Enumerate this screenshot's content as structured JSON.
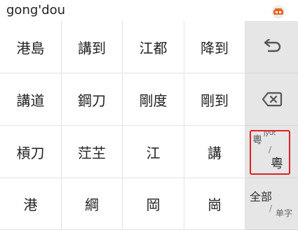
{
  "composition": {
    "text": "gong'dou"
  },
  "app": {
    "logo_icon": "ime-app-logo-icon"
  },
  "candidates": [
    [
      "港島",
      "講到",
      "江都",
      "降到"
    ],
    [
      "講道",
      "鋼刀",
      "剛度",
      "剛到"
    ],
    [
      "槓刀",
      "茳芏",
      "江",
      "講"
    ],
    [
      "港",
      "綱",
      "岡",
      "崗"
    ]
  ],
  "side": {
    "enter_icon": "return-arrow-icon",
    "backspace_icon": "backspace-icon",
    "mode": {
      "top": "粵",
      "sup": "jyut",
      "slash": "/",
      "bottom": "粵"
    },
    "all": {
      "top": "全部",
      "slash": "/",
      "bottom": "单字"
    }
  },
  "colors": {
    "highlight": "#e02020",
    "side_bg": "#e6e6e6",
    "logo": "#e8641e"
  }
}
